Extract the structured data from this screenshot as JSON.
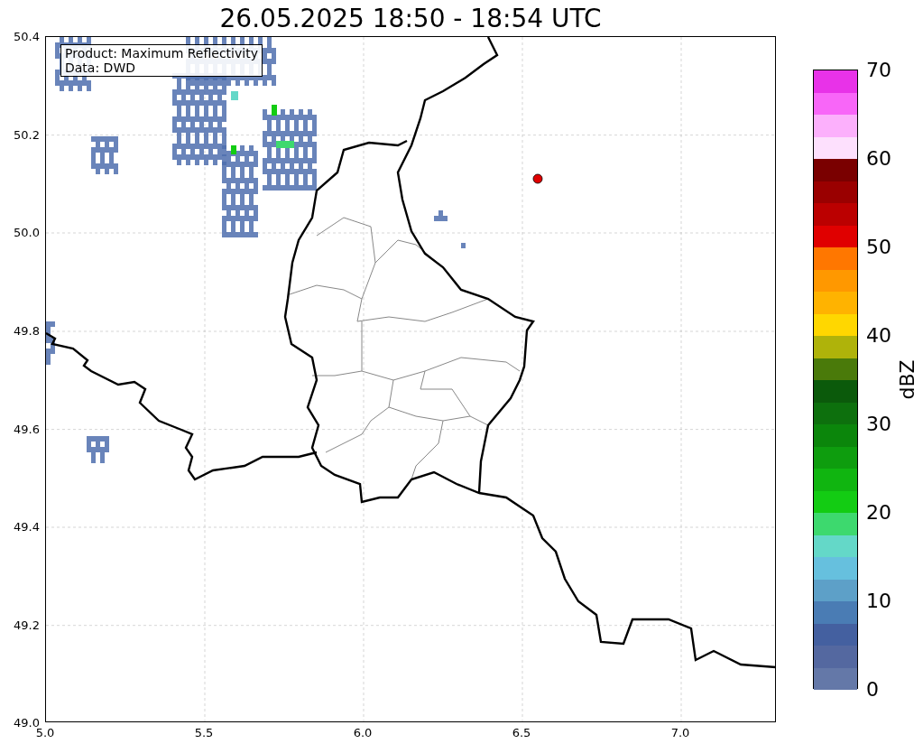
{
  "title": "26.05.2025 18:50 - 18:54 UTC",
  "info_box": [
    "Product: Maximum Reflectivity",
    "Data: DWD"
  ],
  "map": {
    "xticks": [
      "5.0",
      "5.5",
      "6.0",
      "6.5",
      "7.0"
    ],
    "yticks": [
      "50.4",
      "50.2",
      "50.0",
      "49.8",
      "49.6",
      "49.4",
      "49.2",
      "49.0"
    ]
  },
  "colorbar": {
    "label": "dBZ",
    "ticks": [
      "70",
      "60",
      "50",
      "40",
      "30",
      "20",
      "10",
      "0"
    ],
    "segments": [
      {
        "color": "#e832e8"
      },
      {
        "color": "#f866f8"
      },
      {
        "color": "#fcb0fc"
      },
      {
        "color": "#fde0fd"
      },
      {
        "color": "#7a0000"
      },
      {
        "color": "#9a0000"
      },
      {
        "color": "#bb0000"
      },
      {
        "color": "#e00000"
      },
      {
        "color": "#ff7700"
      },
      {
        "color": "#ff9800"
      },
      {
        "color": "#ffb300"
      },
      {
        "color": "#ffd700"
      },
      {
        "color": "#afb30a"
      },
      {
        "color": "#4a7a0a"
      },
      {
        "color": "#0b5a0b"
      },
      {
        "color": "#0d700d"
      },
      {
        "color": "#0b860b"
      },
      {
        "color": "#0e9d0e"
      },
      {
        "color": "#10b510"
      },
      {
        "color": "#13cc13"
      },
      {
        "color": "#3dd96e"
      },
      {
        "color": "#64d8c8"
      },
      {
        "color": "#66c0de"
      },
      {
        "color": "#5da0c8"
      },
      {
        "color": "#4a7cb4"
      },
      {
        "color": "#4460a0"
      },
      {
        "color": "#5468a0"
      },
      {
        "color": "#6478a8"
      }
    ]
  }
}
